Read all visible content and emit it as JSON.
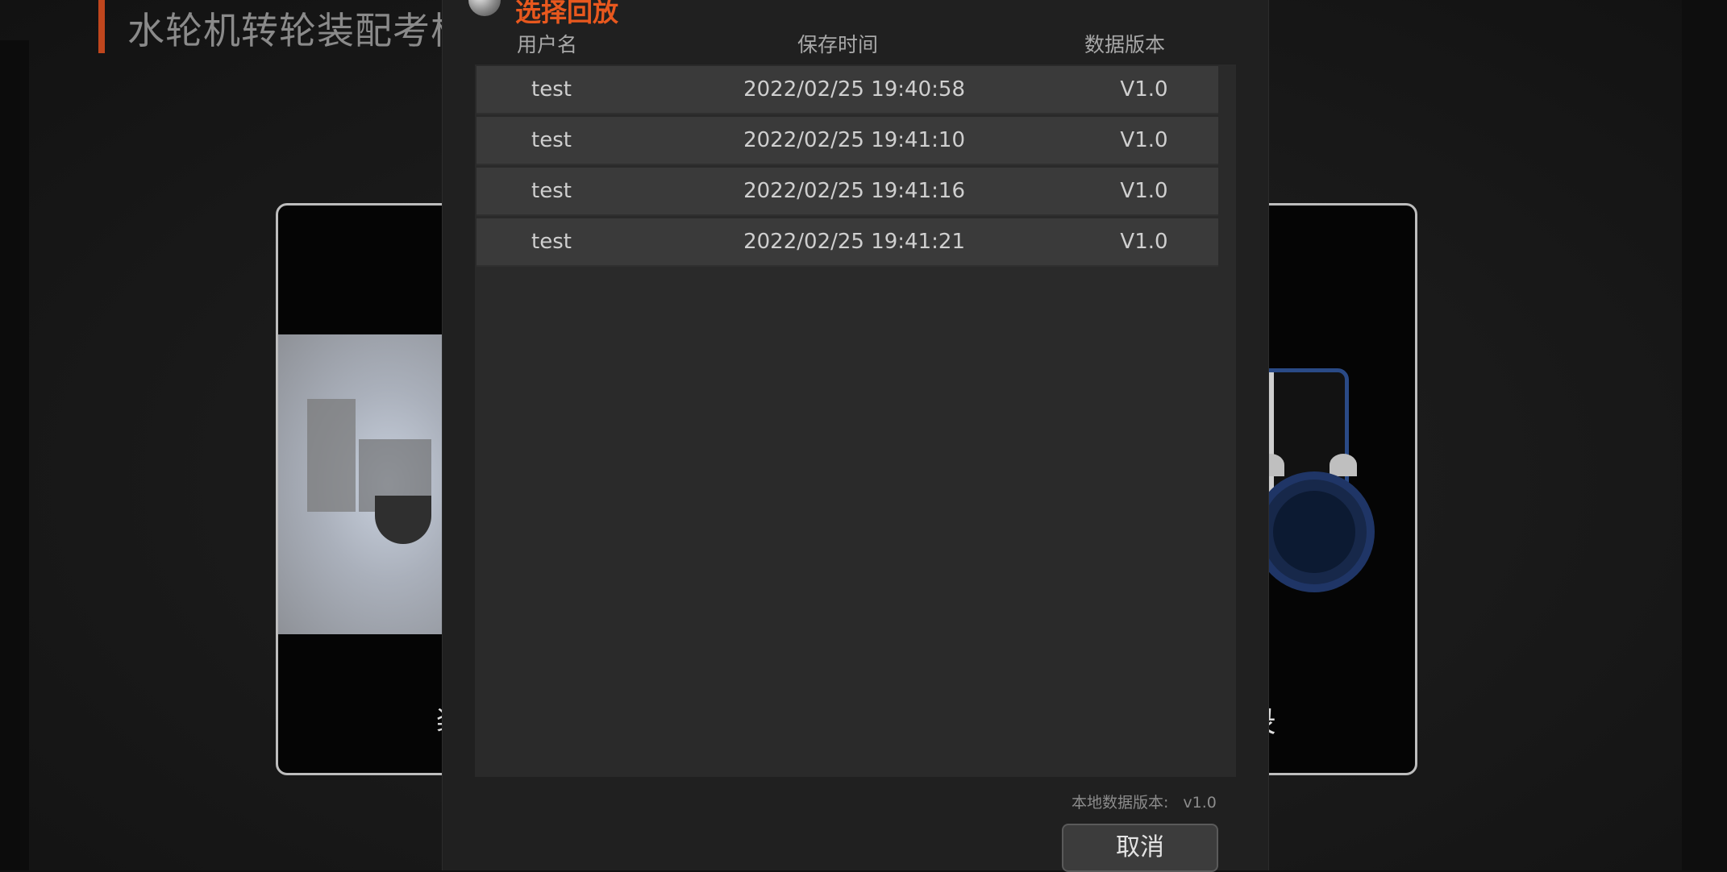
{
  "page": {
    "title": "水轮机转轮装配考核"
  },
  "background_cards": {
    "left_caption": "装",
    "right_caption": "录"
  },
  "dialog": {
    "title": "选择回放",
    "columns": {
      "user": "用户名",
      "time": "保存时间",
      "version": "数据版本"
    },
    "rows": [
      {
        "user": "test",
        "time": "2022/02/25 19:40:58",
        "version": "V1.0"
      },
      {
        "user": "test",
        "time": "2022/02/25 19:41:10",
        "version": "V1.0"
      },
      {
        "user": "test",
        "time": "2022/02/25 19:41:16",
        "version": "V1.0"
      },
      {
        "user": "test",
        "time": "2022/02/25 19:41:21",
        "version": "V1.0"
      }
    ],
    "local_version_label": "本地数据版本:",
    "local_version_value": "v1.0",
    "cancel_label": "取消"
  },
  "colors": {
    "accent": "#e8581e",
    "title_bar_accent": "#c0461d",
    "dialog_bg": "#202020",
    "row_bg": "#3a3a3a"
  },
  "icons": {
    "dialog_knob": "round-knob-icon"
  }
}
